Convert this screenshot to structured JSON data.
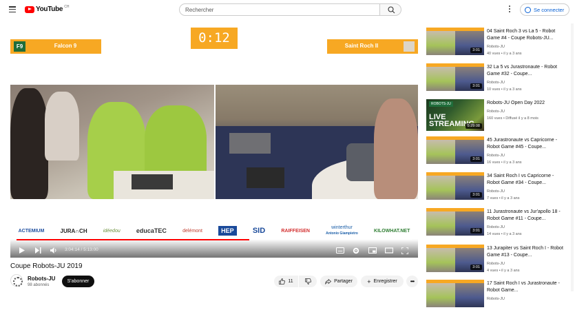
{
  "header": {
    "logo_text": "YouTube",
    "logo_country": "CH",
    "search_placeholder": "Rechercher",
    "signin_label": "Se connecter"
  },
  "video": {
    "scoreboard": {
      "left_code": "F9",
      "left_team": "Falcon 9",
      "timer": "0:12",
      "right_team": "Saint Roch II"
    },
    "sponsors": [
      "ACTEMIUM",
      "JURA∩CH",
      "idéedou",
      "educaTEC",
      "delémont",
      "HEP",
      "SID",
      "RAIFFEISEN",
      "winterthur",
      "KILOWHAT.NET"
    ],
    "sponsor_sub": "Antonio Giampietro",
    "time_current": "3:04:14",
    "time_total": "5:13:00",
    "progress": 0.588
  },
  "title": "Coupe Robots-JU 2019",
  "channel": {
    "name": "Robots-JU",
    "subs": "98 abonnés",
    "subscribe_label": "S'abonner"
  },
  "actions": {
    "likes": "11",
    "share_label": "Partager",
    "save_label": "Enregistrer"
  },
  "sidebar": [
    {
      "title": "04 Saint Roch 3 vs La 5 - Robot Game #4 - Coupe Robots-JU...",
      "channel": "Robots-JU",
      "meta": "40 vues • il y a 3 ans",
      "duration": "3:01"
    },
    {
      "title": "32 La 5 vs Jurastronaute - Robot Game #32 - Coupe...",
      "channel": "Robots-JU",
      "meta": "10 vues • il y a 3 ans",
      "duration": "3:01"
    },
    {
      "title": "Robots-JU Open Day 2022",
      "channel": "Robots-JU",
      "meta": "160 vues • Diffusé il y a 8 mois",
      "duration": "5:29:08",
      "live_badge": "ROBOTS-JU",
      "live_text": "LIVE STREAMING"
    },
    {
      "title": "45 Jurastronaute vs Capricorne - Robot Game #45 - Coupe...",
      "channel": "Robots-JU",
      "meta": "16 vues • il y a 3 ans",
      "duration": "3:01"
    },
    {
      "title": "34 Saint Roch I vs Capricorne - Robot Game #34 - Coupe...",
      "channel": "Robots-JU",
      "meta": "7 vues • il y a 3 ans",
      "duration": "3:01"
    },
    {
      "title": "11 Jurastronaute vs Jur'apollo 18 - Robot Game #11 - Coupe...",
      "channel": "Robots-JU",
      "meta": "14 vues • il y a 3 ans",
      "duration": "3:01"
    },
    {
      "title": "13 Jurapiter vs Saint Roch I - Robot Game #13 - Coupe...",
      "channel": "Robots-JU",
      "meta": "4 vues • il y a 3 ans",
      "duration": "3:01"
    },
    {
      "title": "17 Saint Roch I vs Jurastronaute - Robot Game...",
      "channel": "Robots-JU",
      "meta": "",
      "duration": ""
    }
  ],
  "colors": {
    "accent_orange": "#f7a823",
    "team_green": "#1f6d3a",
    "progress_red": "#ff0000"
  }
}
